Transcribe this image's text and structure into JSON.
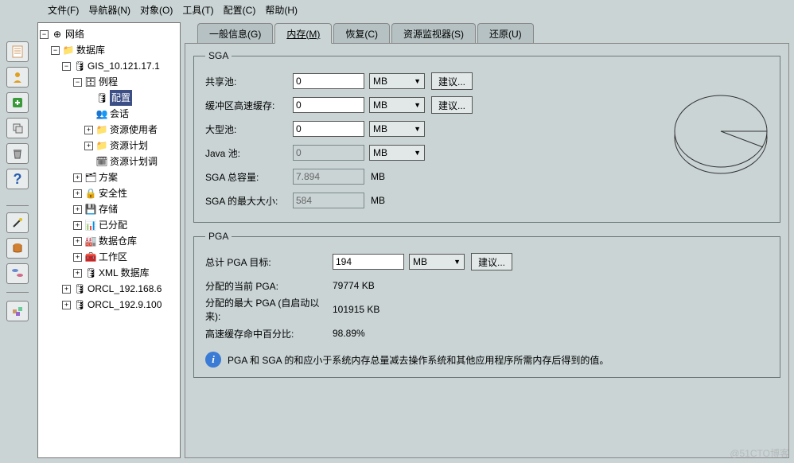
{
  "menu": {
    "file": "文件(F)",
    "nav": "导航器(N)",
    "obj": "对象(O)",
    "tool": "工具(T)",
    "config": "配置(C)",
    "help": "帮助(H)"
  },
  "tree": {
    "root": "网络",
    "db": "数据库",
    "gis": "GIS_10.121.17.1",
    "inst": "例程",
    "cfg": "配置",
    "sess": "会话",
    "resuser": "资源使用者",
    "resplan": "资源计划",
    "resplansched": "资源计划调",
    "scheme": "方案",
    "security": "安全性",
    "storage": "存储",
    "alloc": "已分配",
    "dw": "数据仓库",
    "workspace": "工作区",
    "xmldb": "XML 数据库",
    "orcl1": "ORCL_192.168.6",
    "orcl2": "ORCL_192.9.100"
  },
  "tabs": {
    "general": "一般信息(G)",
    "memory": "内存(M)",
    "recovery": "恢复(C)",
    "resmon": "资源监视器(S)",
    "undo": "还原(U)"
  },
  "sga": {
    "legend": "SGA",
    "shared_pool": "共享池:",
    "shared_pool_val": "0",
    "buffer_cache": "缓冲区高速缓存:",
    "buffer_cache_val": "0",
    "large_pool": "大型池:",
    "large_pool_val": "0",
    "java_pool": "Java 池:",
    "java_pool_val": "0",
    "total": "SGA 总容量:",
    "total_val": "7.894",
    "max": "SGA 的最大大小:",
    "max_val": "584",
    "mb": "MB",
    "advise": "建议..."
  },
  "pga": {
    "legend": "PGA",
    "target": "总计 PGA 目标:",
    "target_val": "194",
    "mb": "MB",
    "advise": "建议...",
    "current": "分配的当前 PGA:",
    "current_val": "79774 KB",
    "max_since": "分配的最大 PGA (自启动以来):",
    "max_since_val": "101915 KB",
    "hit": "高速缓存命中百分比:",
    "hit_val": "98.89%"
  },
  "info": "PGA 和 SGA 的和应小于系统内存总量减去操作系统和其他应用程序所需内存后得到的值。",
  "watermark": "@51CTO博客",
  "chart_data": {
    "type": "pie",
    "title": "",
    "slices": [
      {
        "name": "segment-1",
        "value": 93
      },
      {
        "name": "segment-2",
        "value": 7
      }
    ]
  }
}
